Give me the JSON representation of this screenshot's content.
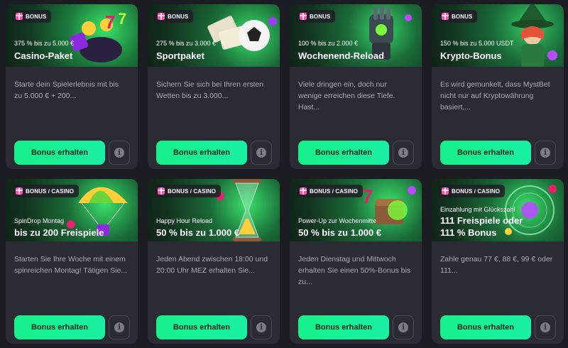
{
  "colors": {
    "button": "#17f08a",
    "card": "#2b2c33",
    "page": "#1c1d22",
    "tag_icon": "#ff4fa8"
  },
  "cards": [
    {
      "tag": "BONUS",
      "subtitle": "375 % bis zu 5.000 €",
      "title": "Casino-Paket",
      "description": "Starte dein Spielerlebnis mit bis zu 5.000 € + 200...",
      "button": "Bonus erhalten",
      "info": "i",
      "art": "slot-pot-icon"
    },
    {
      "tag": "BONUS",
      "subtitle": "275 % bis zu 3.000 €",
      "title": "Sportpaket",
      "description": "Sichern Sie sich bei Ihren ersten Wetten bis zu 3.000...",
      "button": "Bonus erhalten",
      "info": "i",
      "art": "football-icon"
    },
    {
      "tag": "BONUS",
      "subtitle": "100 % bis zu 2.000 €",
      "title": "Wochenend-Reload",
      "description": "Viele dringen ein, doch nur wenige erreichen diese Tiefe. Hast...",
      "button": "Bonus erhalten",
      "info": "i",
      "art": "gauntlet-icon"
    },
    {
      "tag": "BONUS",
      "subtitle": "150 % bis zu 5.000 USDT",
      "title": "Krypto-Bonus",
      "description": "Es wird gemunkelt, dass MystBet nicht nur auf Kryptowährung basiert,...",
      "button": "Bonus erhalten",
      "info": "i",
      "art": "wizard-icon"
    },
    {
      "tag": "BONUS / CASINO",
      "subtitle": "SpinDrop Montag",
      "title": "bis zu 200 Freispiele",
      "description": "Starten Sie Ihre Woche mit einem spinreichen Montag! Tätigen Sie...",
      "button": "Bonus erhalten",
      "info": "i",
      "art": "parachute-icon"
    },
    {
      "tag": "BONUS / CASINO",
      "subtitle": "Happy Hour Reload",
      "title": "50 % bis zu 1.000 €",
      "description": "Jeden Abend zwischen 18:00 und 20:00 Uhr MEZ erhalten Sie...",
      "button": "Bonus erhalten",
      "info": "i",
      "art": "hourglass-icon"
    },
    {
      "tag": "BONUS / CASINO",
      "subtitle": "Power-Up zur Wochenmitte",
      "title": "50 % bis zu 1.000 €",
      "description": "Jeden Dienstag und Mittwoch erhalten Sie einen 50%-Bonus bis zu...",
      "button": "Bonus erhalten",
      "info": "i",
      "art": "treasure-icon"
    },
    {
      "tag": "BONUS / CASINO",
      "subtitle": "Einzahlung mit Glückszahl",
      "title": "111 Freispiele oder 111 % Bonus",
      "description": "Zahle genau 77 €, 88 €, 99 € oder 111...",
      "button": "Bonus erhalten",
      "info": "i",
      "art": "magic-circle-icon"
    }
  ]
}
